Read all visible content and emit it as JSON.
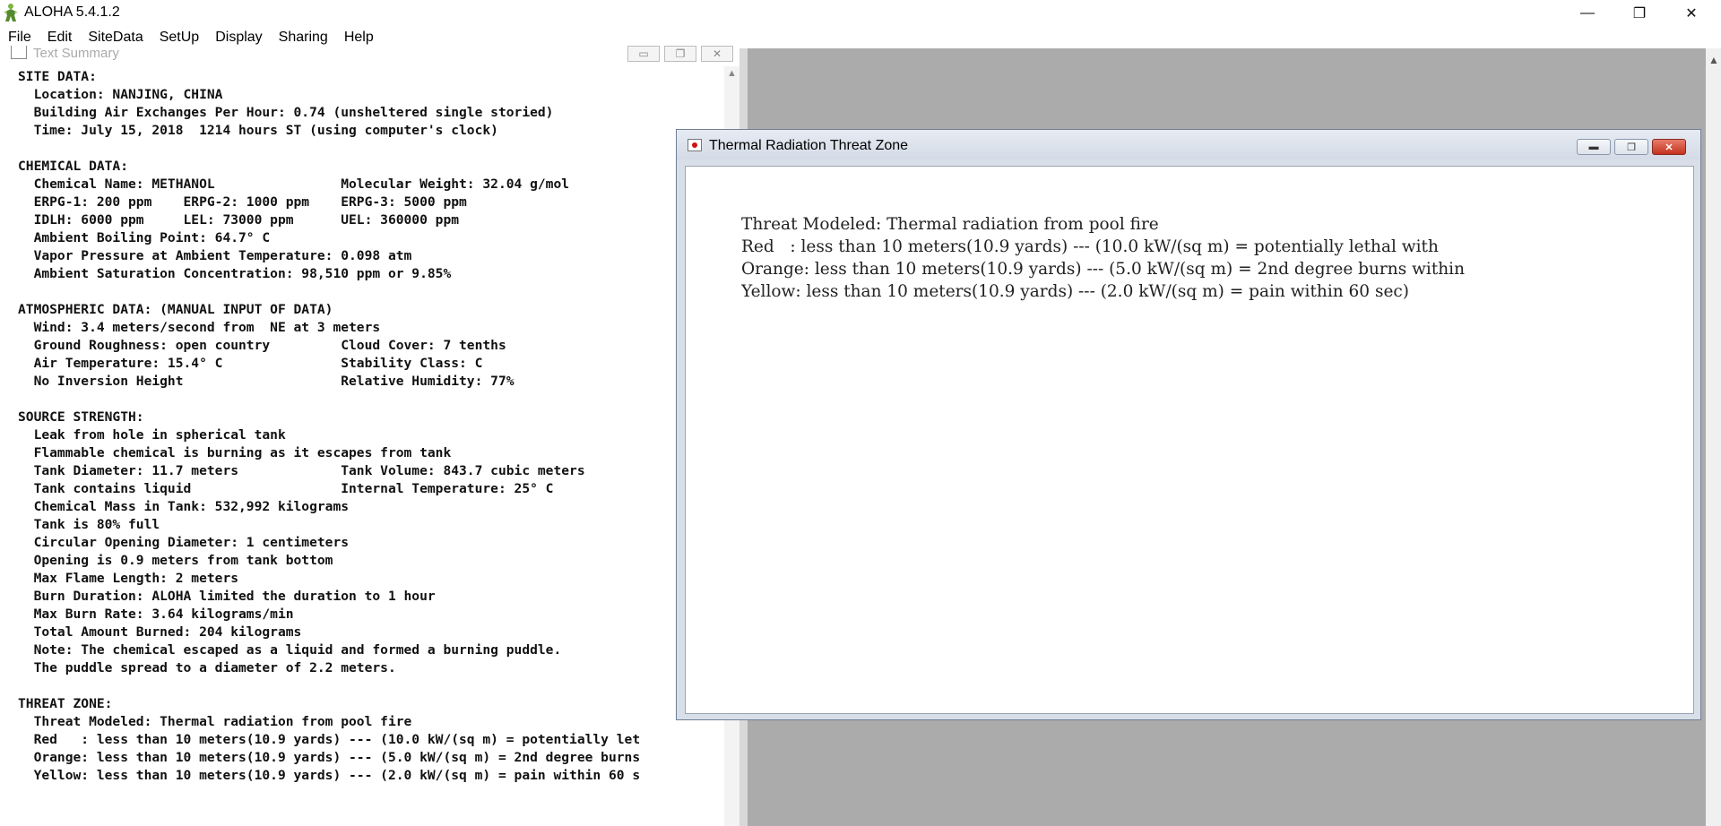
{
  "app": {
    "title": "ALOHA 5.4.1.2",
    "window_buttons": {
      "minimize": "—",
      "restore": "❐",
      "close": "✕"
    }
  },
  "menu": [
    "File",
    "Edit",
    "SiteData",
    "SetUp",
    "Display",
    "Sharing",
    "Help"
  ],
  "text_summary": {
    "title": "Text Summary",
    "lines": [
      "SITE DATA:",
      "  Location: NANJING, CHINA",
      "  Building Air Exchanges Per Hour: 0.74 (unsheltered single storied)",
      "  Time: July 15, 2018  1214 hours ST (using computer's clock)",
      "",
      "CHEMICAL DATA:",
      "  Chemical Name: METHANOL                Molecular Weight: 32.04 g/mol",
      "  ERPG-1: 200 ppm    ERPG-2: 1000 ppm    ERPG-3: 5000 ppm",
      "  IDLH: 6000 ppm     LEL: 73000 ppm      UEL: 360000 ppm",
      "  Ambient Boiling Point: 64.7° C",
      "  Vapor Pressure at Ambient Temperature: 0.098 atm",
      "  Ambient Saturation Concentration: 98,510 ppm or 9.85%",
      "",
      "ATMOSPHERIC DATA: (MANUAL INPUT OF DATA)",
      "  Wind: 3.4 meters/second from  NE at 3 meters",
      "  Ground Roughness: open country         Cloud Cover: 7 tenths",
      "  Air Temperature: 15.4° C               Stability Class: C",
      "  No Inversion Height                    Relative Humidity: 77%",
      "",
      "SOURCE STRENGTH:",
      "  Leak from hole in spherical tank",
      "  Flammable chemical is burning as it escapes from tank",
      "  Tank Diameter: 11.7 meters             Tank Volume: 843.7 cubic meters",
      "  Tank contains liquid                   Internal Temperature: 25° C",
      "  Chemical Mass in Tank: 532,992 kilograms",
      "  Tank is 80% full",
      "  Circular Opening Diameter: 1 centimeters",
      "  Opening is 0.9 meters from tank bottom",
      "  Max Flame Length: 2 meters",
      "  Burn Duration: ALOHA limited the duration to 1 hour",
      "  Max Burn Rate: 3.64 kilograms/min",
      "  Total Amount Burned: 204 kilograms",
      "  Note: The chemical escaped as a liquid and formed a burning puddle.",
      "  The puddle spread to a diameter of 2.2 meters.",
      "",
      "THREAT ZONE:",
      "  Threat Modeled: Thermal radiation from pool fire",
      "  Red   : less than 10 meters(10.9 yards) --- (10.0 kW/(sq m) = potentially let",
      "  Orange: less than 10 meters(10.9 yards) --- (5.0 kW/(sq m) = 2nd degree burns",
      "  Yellow: less than 10 meters(10.9 yards) --- (2.0 kW/(sq m) = pain within 60 s"
    ]
  },
  "thermal_window": {
    "title": "Thermal Radiation Threat Zone",
    "lines": [
      "Threat Modeled: Thermal radiation from pool fire",
      "Red   : less than 10 meters(10.9 yards) --- (10.0 kW/(sq m) = potentially lethal with",
      "Orange: less than 10 meters(10.9 yards) --- (5.0 kW/(sq m) = 2nd degree burns within",
      "Yellow: less than 10 meters(10.9 yards) --- (2.0 kW/(sq m) = pain within 60 sec)"
    ]
  }
}
